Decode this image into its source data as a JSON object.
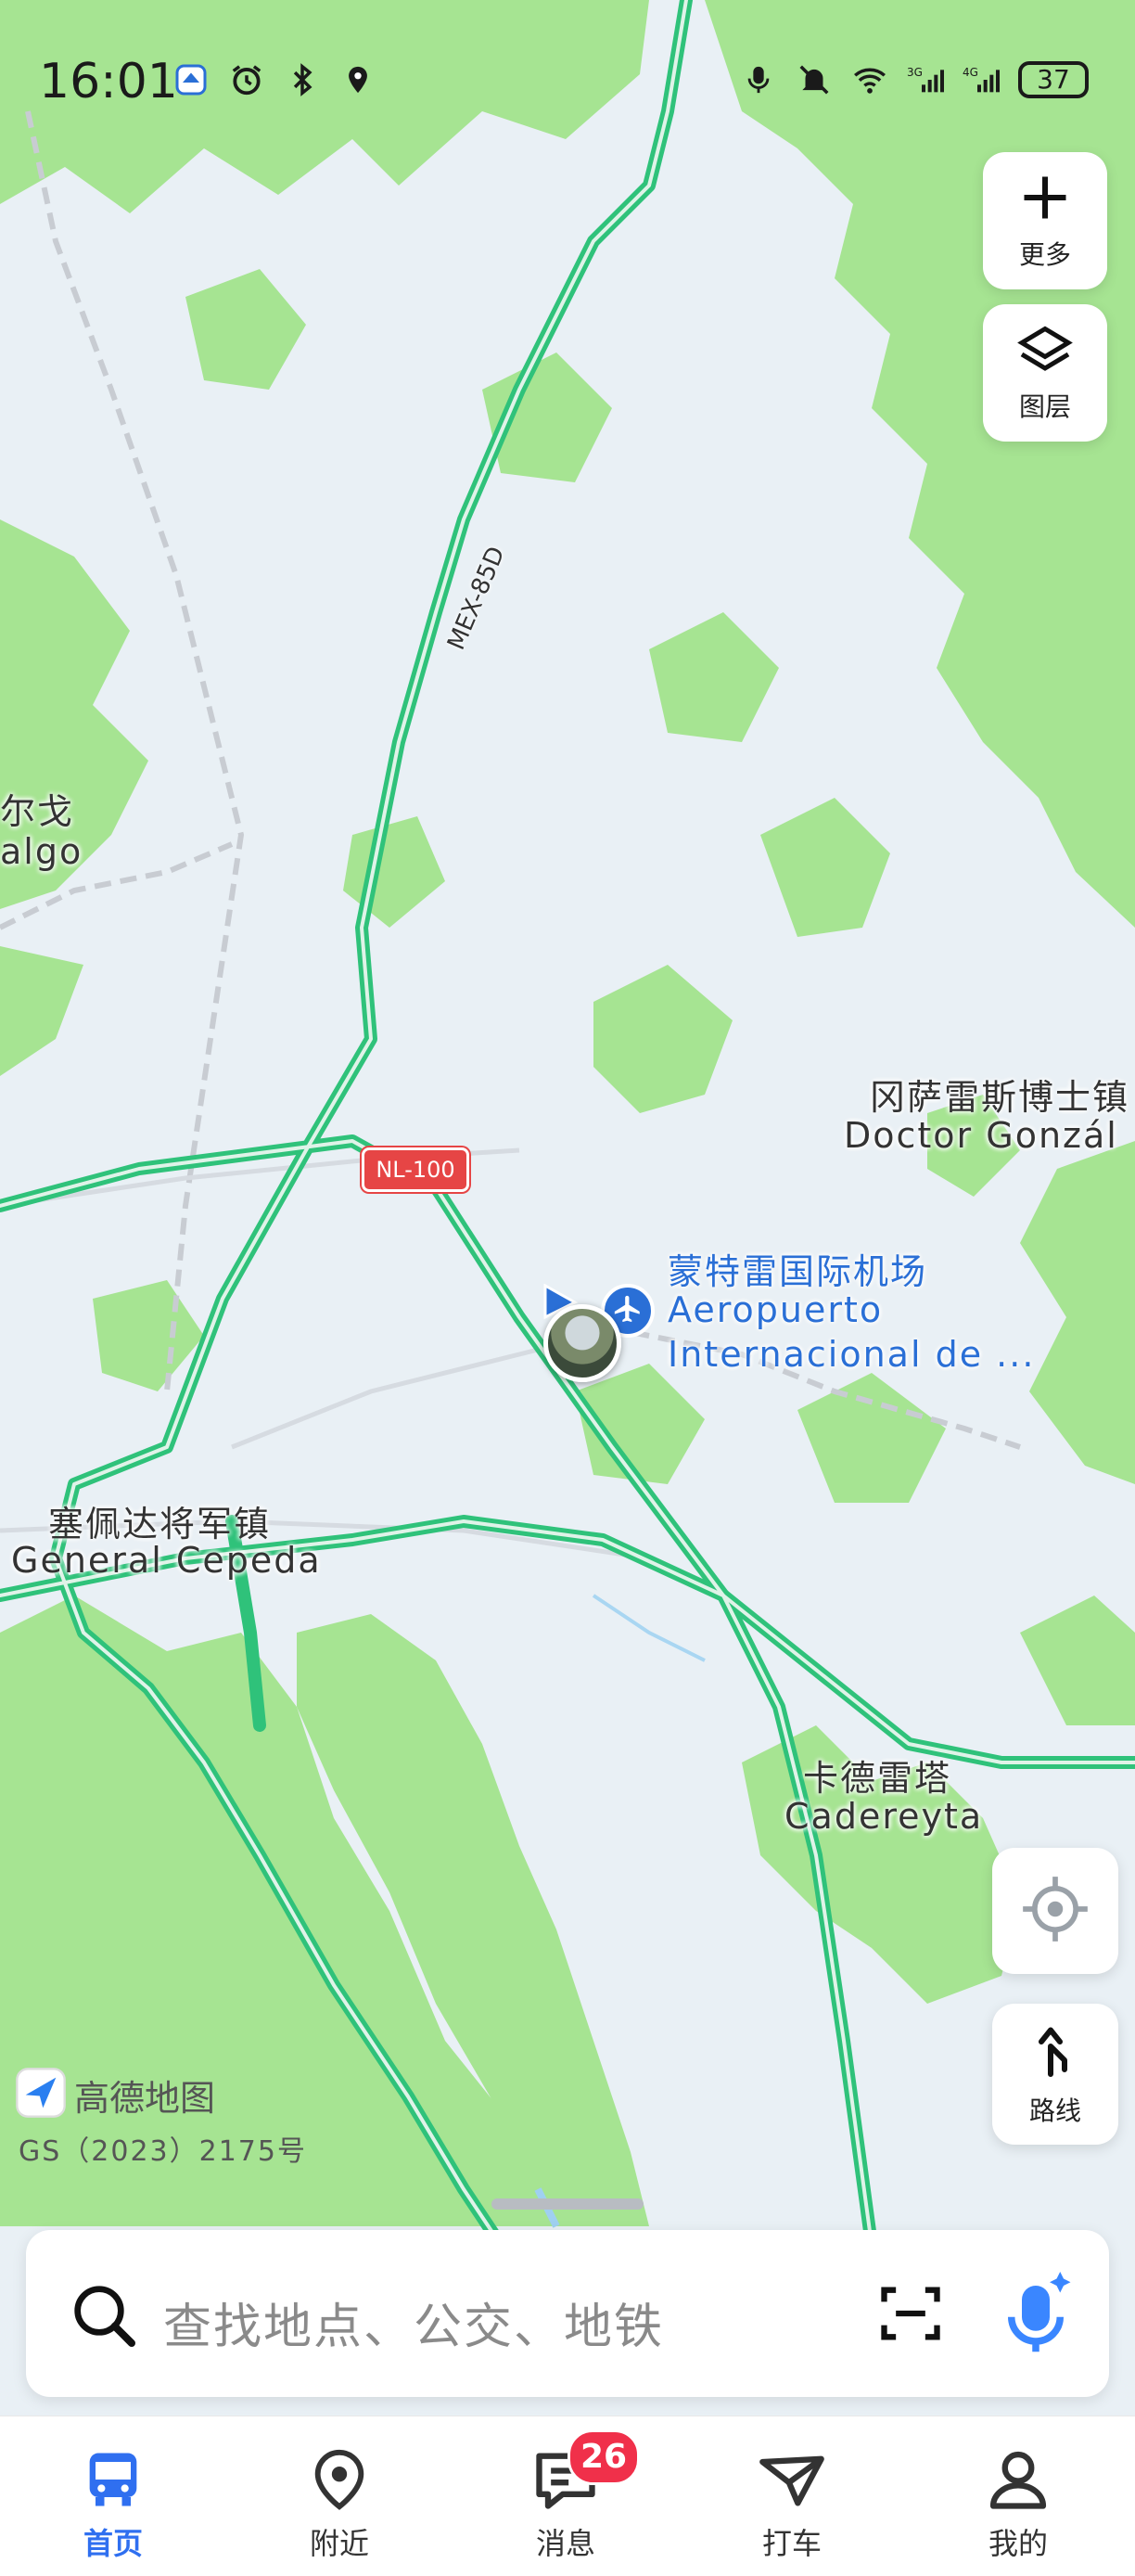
{
  "status_bar": {
    "time": "16:01",
    "battery": "37",
    "icons_left": [
      "app-notification-icon",
      "alarm-icon",
      "bluetooth-icon",
      "location-icon"
    ],
    "icons_right": [
      "microphone-icon",
      "mute-icon",
      "wifi-icon",
      "signal-3g-icon",
      "signal-4g-icon"
    ]
  },
  "right_controls": {
    "more_label": "更多",
    "layers_label": "图层",
    "route_label": "路线"
  },
  "map": {
    "labels": {
      "left_edge_cn": "尔戈",
      "left_edge_en": "algo",
      "town1_cn": "塞佩达将军镇",
      "town1_en": "General Cepeda",
      "town2_cn": "卡德雷塔",
      "town2_en": "Cadereyta",
      "town3_cn": "冈萨雷斯博士镇",
      "town3_en": "Doctor Gonzál",
      "airport_cn": "蒙特雷国际机场",
      "airport_en1": "Aeropuerto",
      "airport_en2": "Internacional de ..."
    },
    "road_shield": "NL-100",
    "road_name": "MEX-85D",
    "colors": {
      "land": "#e9f0f5",
      "vegetation": "#a6e492",
      "highway": "#2fc27a",
      "airport_blue": "#2a6fd6",
      "shield_red": "#e64545"
    }
  },
  "brand": {
    "name": "高德地图",
    "license": "GS（2023）2175号"
  },
  "search": {
    "placeholder": "查找地点、公交、地铁"
  },
  "bottom_nav": {
    "items": [
      {
        "label": "首页",
        "icon": "bus-icon",
        "active": true
      },
      {
        "label": "附近",
        "icon": "location-pin-icon",
        "active": false
      },
      {
        "label": "消息",
        "icon": "message-icon",
        "active": false,
        "badge": "26"
      },
      {
        "label": "打车",
        "icon": "taxi-icon",
        "active": false
      },
      {
        "label": "我的",
        "icon": "user-icon",
        "active": false
      }
    ]
  }
}
